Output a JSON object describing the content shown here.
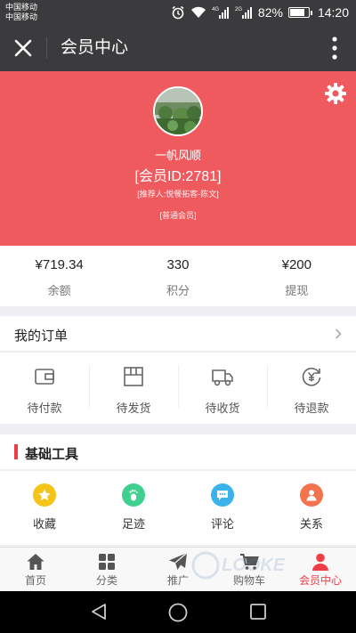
{
  "status_bar": {
    "carrier_1": "中国移动",
    "carrier_2": "中国移动",
    "network_1": "4G",
    "network_2": "2G",
    "battery": "82%",
    "battery_level": 0.82,
    "time": "14:20"
  },
  "nav": {
    "title": "会员中心",
    "close_icon": "close-icon",
    "more_icon": "more-vertical-icon"
  },
  "profile": {
    "username": "一帆风顺",
    "member_id": "[会员ID:2781]",
    "referrer": "[推荐人:悦餐拓客-陈文]",
    "level": "[普通会员]",
    "accent_color": "#ef5a5f"
  },
  "stats": [
    {
      "value": "¥719.34",
      "label": "余额"
    },
    {
      "value": "330",
      "label": "积分"
    },
    {
      "value": "¥200",
      "label": "提现"
    }
  ],
  "orders": {
    "title": "我的订单",
    "items": [
      {
        "label": "待付款",
        "icon": "wallet-icon"
      },
      {
        "label": "待发货",
        "icon": "package-icon"
      },
      {
        "label": "待收货",
        "icon": "truck-icon"
      },
      {
        "label": "待退款",
        "icon": "refund-icon"
      }
    ]
  },
  "tools": {
    "title": "基础工具",
    "items": [
      {
        "label": "收藏",
        "icon": "star-icon",
        "color": "#f5c418"
      },
      {
        "label": "足迹",
        "icon": "footprint-icon",
        "color": "#3fcf8e"
      },
      {
        "label": "评论",
        "icon": "comment-icon",
        "color": "#3ab3ec"
      },
      {
        "label": "关系",
        "icon": "relation-icon",
        "color": "#f2734e"
      }
    ]
  },
  "tabbar": {
    "items": [
      {
        "label": "首页",
        "icon": "home-icon"
      },
      {
        "label": "分类",
        "icon": "grid-icon"
      },
      {
        "label": "推广",
        "icon": "paper-plane-icon"
      },
      {
        "label": "购物车",
        "icon": "cart-icon"
      },
      {
        "label": "会员中心",
        "icon": "user-icon"
      }
    ],
    "active_color": "#ef3d45"
  },
  "watermark": "LOOKE"
}
